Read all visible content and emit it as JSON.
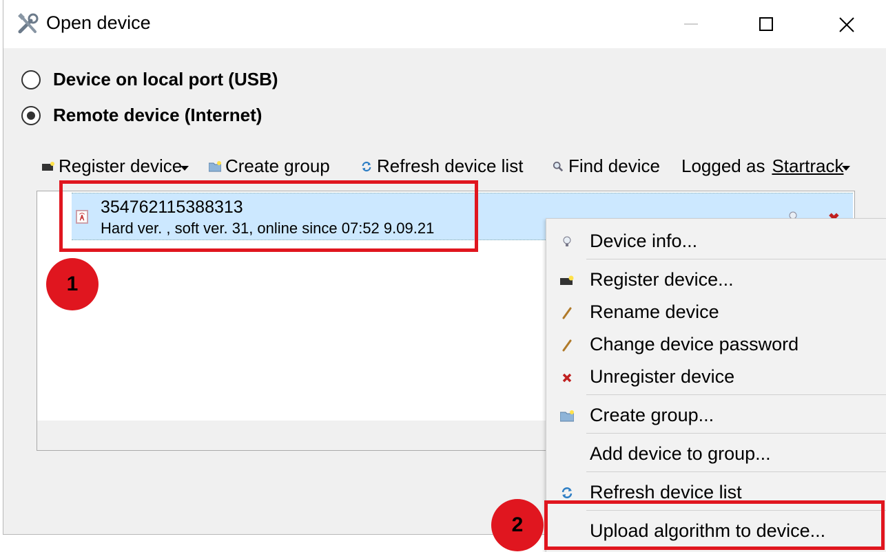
{
  "window": {
    "title": "Open device"
  },
  "connection": {
    "options": [
      {
        "label": "Device on local port (USB)",
        "checked": false
      },
      {
        "label": "Remote device (Internet)",
        "checked": true
      }
    ]
  },
  "toolbar": {
    "register_device": "Register device",
    "create_group": "Create group",
    "refresh_list": "Refresh device list",
    "find_device": "Find device",
    "logged_as_label": "Logged as",
    "username": "Startrack"
  },
  "device_list": {
    "items": [
      {
        "id": "354762115388313",
        "details": "Hard ver. , soft ver. 31, online since 07:52 9.09.21"
      }
    ]
  },
  "context_menu": {
    "items": [
      {
        "label": "Device info...",
        "icon": "bulb-icon"
      },
      {
        "label": "Register device...",
        "icon": "register-device-icon"
      },
      {
        "label": "Rename device",
        "icon": "pencil-icon"
      },
      {
        "label": "Change device password",
        "icon": "pencil-icon"
      },
      {
        "label": "Unregister device",
        "icon": "x-icon"
      },
      {
        "label": "Create group...",
        "icon": "folder-icon"
      },
      {
        "label": "Add device to group...",
        "icon": ""
      },
      {
        "label": "Refresh device list",
        "icon": "refresh-icon"
      },
      {
        "label": "Upload algorithm to device...",
        "icon": ""
      }
    ]
  },
  "annotations": {
    "badge_1": "1",
    "badge_2": "2"
  },
  "colors": {
    "highlight": "#e0161f",
    "selection": "#cce8ff",
    "window_bg": "#f0f0f0"
  }
}
